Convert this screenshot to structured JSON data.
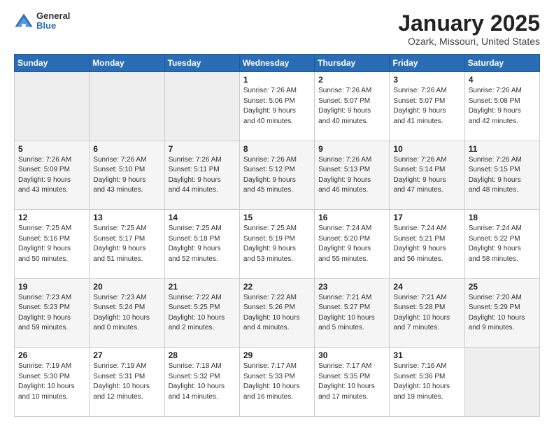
{
  "header": {
    "logo_general": "General",
    "logo_blue": "Blue",
    "month_title": "January 2025",
    "location": "Ozark, Missouri, United States"
  },
  "days_of_week": [
    "Sunday",
    "Monday",
    "Tuesday",
    "Wednesday",
    "Thursday",
    "Friday",
    "Saturday"
  ],
  "weeks": [
    [
      {
        "num": "",
        "info": ""
      },
      {
        "num": "",
        "info": ""
      },
      {
        "num": "",
        "info": ""
      },
      {
        "num": "1",
        "info": "Sunrise: 7:26 AM\nSunset: 5:06 PM\nDaylight: 9 hours\nand 40 minutes."
      },
      {
        "num": "2",
        "info": "Sunrise: 7:26 AM\nSunset: 5:07 PM\nDaylight: 9 hours\nand 40 minutes."
      },
      {
        "num": "3",
        "info": "Sunrise: 7:26 AM\nSunset: 5:07 PM\nDaylight: 9 hours\nand 41 minutes."
      },
      {
        "num": "4",
        "info": "Sunrise: 7:26 AM\nSunset: 5:08 PM\nDaylight: 9 hours\nand 42 minutes."
      }
    ],
    [
      {
        "num": "5",
        "info": "Sunrise: 7:26 AM\nSunset: 5:09 PM\nDaylight: 9 hours\nand 43 minutes."
      },
      {
        "num": "6",
        "info": "Sunrise: 7:26 AM\nSunset: 5:10 PM\nDaylight: 9 hours\nand 43 minutes."
      },
      {
        "num": "7",
        "info": "Sunrise: 7:26 AM\nSunset: 5:11 PM\nDaylight: 9 hours\nand 44 minutes."
      },
      {
        "num": "8",
        "info": "Sunrise: 7:26 AM\nSunset: 5:12 PM\nDaylight: 9 hours\nand 45 minutes."
      },
      {
        "num": "9",
        "info": "Sunrise: 7:26 AM\nSunset: 5:13 PM\nDaylight: 9 hours\nand 46 minutes."
      },
      {
        "num": "10",
        "info": "Sunrise: 7:26 AM\nSunset: 5:14 PM\nDaylight: 9 hours\nand 47 minutes."
      },
      {
        "num": "11",
        "info": "Sunrise: 7:26 AM\nSunset: 5:15 PM\nDaylight: 9 hours\nand 48 minutes."
      }
    ],
    [
      {
        "num": "12",
        "info": "Sunrise: 7:25 AM\nSunset: 5:16 PM\nDaylight: 9 hours\nand 50 minutes."
      },
      {
        "num": "13",
        "info": "Sunrise: 7:25 AM\nSunset: 5:17 PM\nDaylight: 9 hours\nand 51 minutes."
      },
      {
        "num": "14",
        "info": "Sunrise: 7:25 AM\nSunset: 5:18 PM\nDaylight: 9 hours\nand 52 minutes."
      },
      {
        "num": "15",
        "info": "Sunrise: 7:25 AM\nSunset: 5:19 PM\nDaylight: 9 hours\nand 53 minutes."
      },
      {
        "num": "16",
        "info": "Sunrise: 7:24 AM\nSunset: 5:20 PM\nDaylight: 9 hours\nand 55 minutes."
      },
      {
        "num": "17",
        "info": "Sunrise: 7:24 AM\nSunset: 5:21 PM\nDaylight: 9 hours\nand 56 minutes."
      },
      {
        "num": "18",
        "info": "Sunrise: 7:24 AM\nSunset: 5:22 PM\nDaylight: 9 hours\nand 58 minutes."
      }
    ],
    [
      {
        "num": "19",
        "info": "Sunrise: 7:23 AM\nSunset: 5:23 PM\nDaylight: 9 hours\nand 59 minutes."
      },
      {
        "num": "20",
        "info": "Sunrise: 7:23 AM\nSunset: 5:24 PM\nDaylight: 10 hours\nand 0 minutes."
      },
      {
        "num": "21",
        "info": "Sunrise: 7:22 AM\nSunset: 5:25 PM\nDaylight: 10 hours\nand 2 minutes."
      },
      {
        "num": "22",
        "info": "Sunrise: 7:22 AM\nSunset: 5:26 PM\nDaylight: 10 hours\nand 4 minutes."
      },
      {
        "num": "23",
        "info": "Sunrise: 7:21 AM\nSunset: 5:27 PM\nDaylight: 10 hours\nand 5 minutes."
      },
      {
        "num": "24",
        "info": "Sunrise: 7:21 AM\nSunset: 5:28 PM\nDaylight: 10 hours\nand 7 minutes."
      },
      {
        "num": "25",
        "info": "Sunrise: 7:20 AM\nSunset: 5:29 PM\nDaylight: 10 hours\nand 9 minutes."
      }
    ],
    [
      {
        "num": "26",
        "info": "Sunrise: 7:19 AM\nSunset: 5:30 PM\nDaylight: 10 hours\nand 10 minutes."
      },
      {
        "num": "27",
        "info": "Sunrise: 7:19 AM\nSunset: 5:31 PM\nDaylight: 10 hours\nand 12 minutes."
      },
      {
        "num": "28",
        "info": "Sunrise: 7:18 AM\nSunset: 5:32 PM\nDaylight: 10 hours\nand 14 minutes."
      },
      {
        "num": "29",
        "info": "Sunrise: 7:17 AM\nSunset: 5:33 PM\nDaylight: 10 hours\nand 16 minutes."
      },
      {
        "num": "30",
        "info": "Sunrise: 7:17 AM\nSunset: 5:35 PM\nDaylight: 10 hours\nand 17 minutes."
      },
      {
        "num": "31",
        "info": "Sunrise: 7:16 AM\nSunset: 5:36 PM\nDaylight: 10 hours\nand 19 minutes."
      },
      {
        "num": "",
        "info": ""
      }
    ]
  ]
}
